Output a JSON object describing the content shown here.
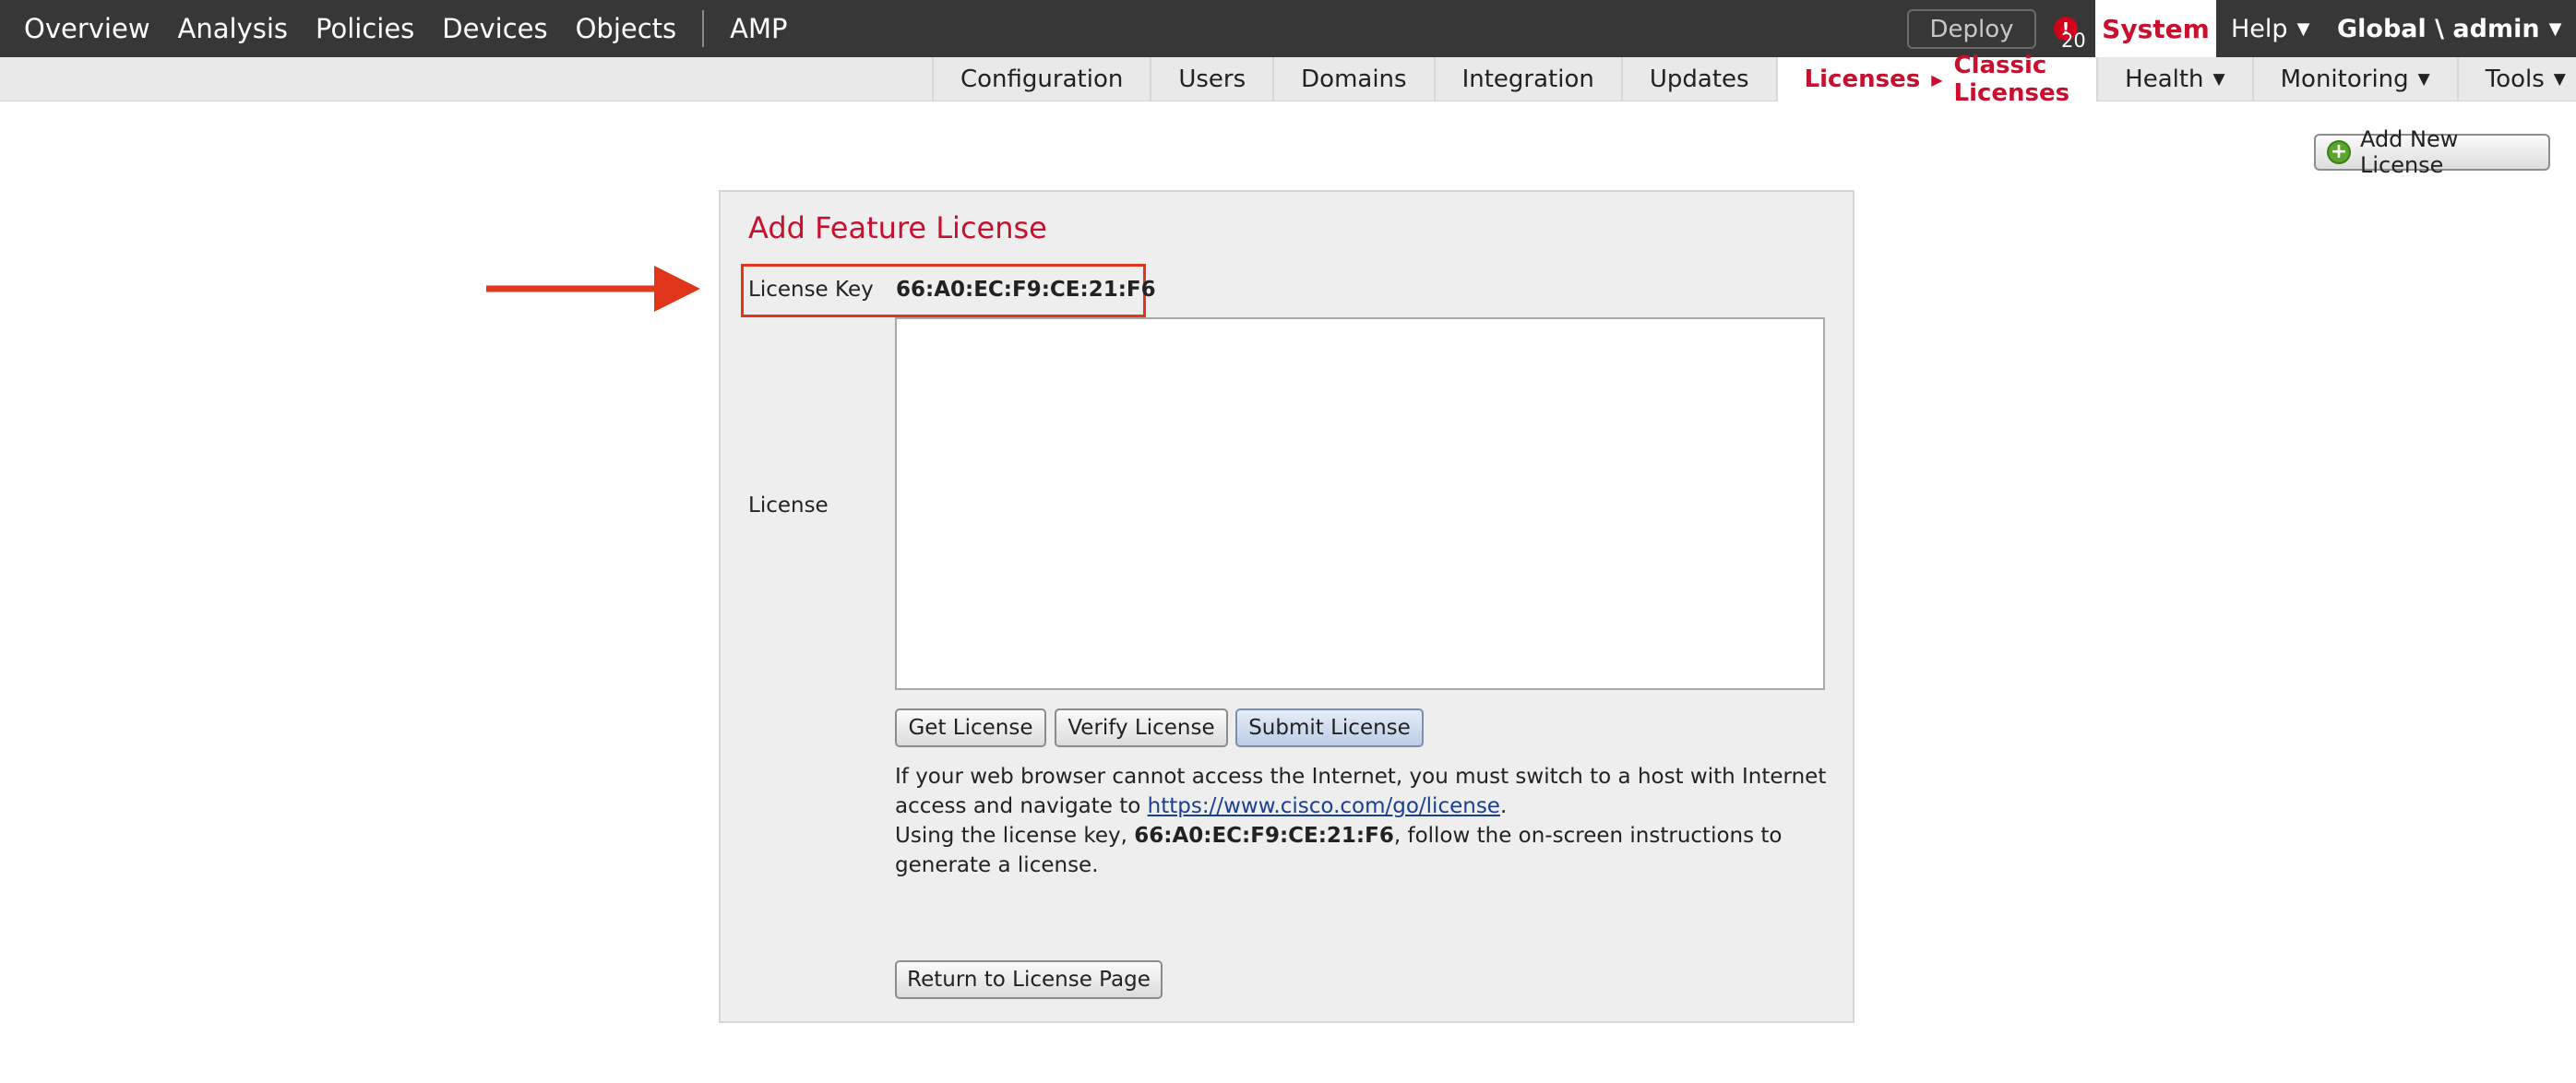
{
  "topnav": {
    "items": [
      "Overview",
      "Analysis",
      "Policies",
      "Devices",
      "Objects",
      "AMP"
    ],
    "deploy": "Deploy",
    "alert_count": "20",
    "system": "System",
    "help": "Help",
    "user": "Global \\ admin"
  },
  "subnav": {
    "items": [
      "Configuration",
      "Users",
      "Domains",
      "Integration",
      "Updates"
    ],
    "active": {
      "main": "Licenses",
      "sub": "Classic Licenses"
    },
    "dropdowns": [
      "Health",
      "Monitoring",
      "Tools"
    ]
  },
  "actions": {
    "add_new_license": "Add New License"
  },
  "panel": {
    "title": "Add Feature License",
    "license_key_label": "License Key",
    "license_key_value": "66:A0:EC:F9:CE:21:F6",
    "license_label": "License",
    "license_value": "",
    "buttons": {
      "get": "Get License",
      "verify": "Verify License",
      "submit": "Submit License"
    },
    "info1_before": "If your web browser cannot access the Internet, you must switch to a host with Internet access and navigate to ",
    "info1_link": "https://www.cisco.com/go/license",
    "info1_after": ".",
    "info2_before": "Using the license key, ",
    "info2_key": "66:A0:EC:F9:CE:21:F6",
    "info2_after": ", follow the on-screen instructions to generate a license.",
    "return_button": "Return to License Page"
  },
  "colors": {
    "accent": "#c8102e",
    "topbar": "#373737",
    "annotation": "#e0361c"
  }
}
